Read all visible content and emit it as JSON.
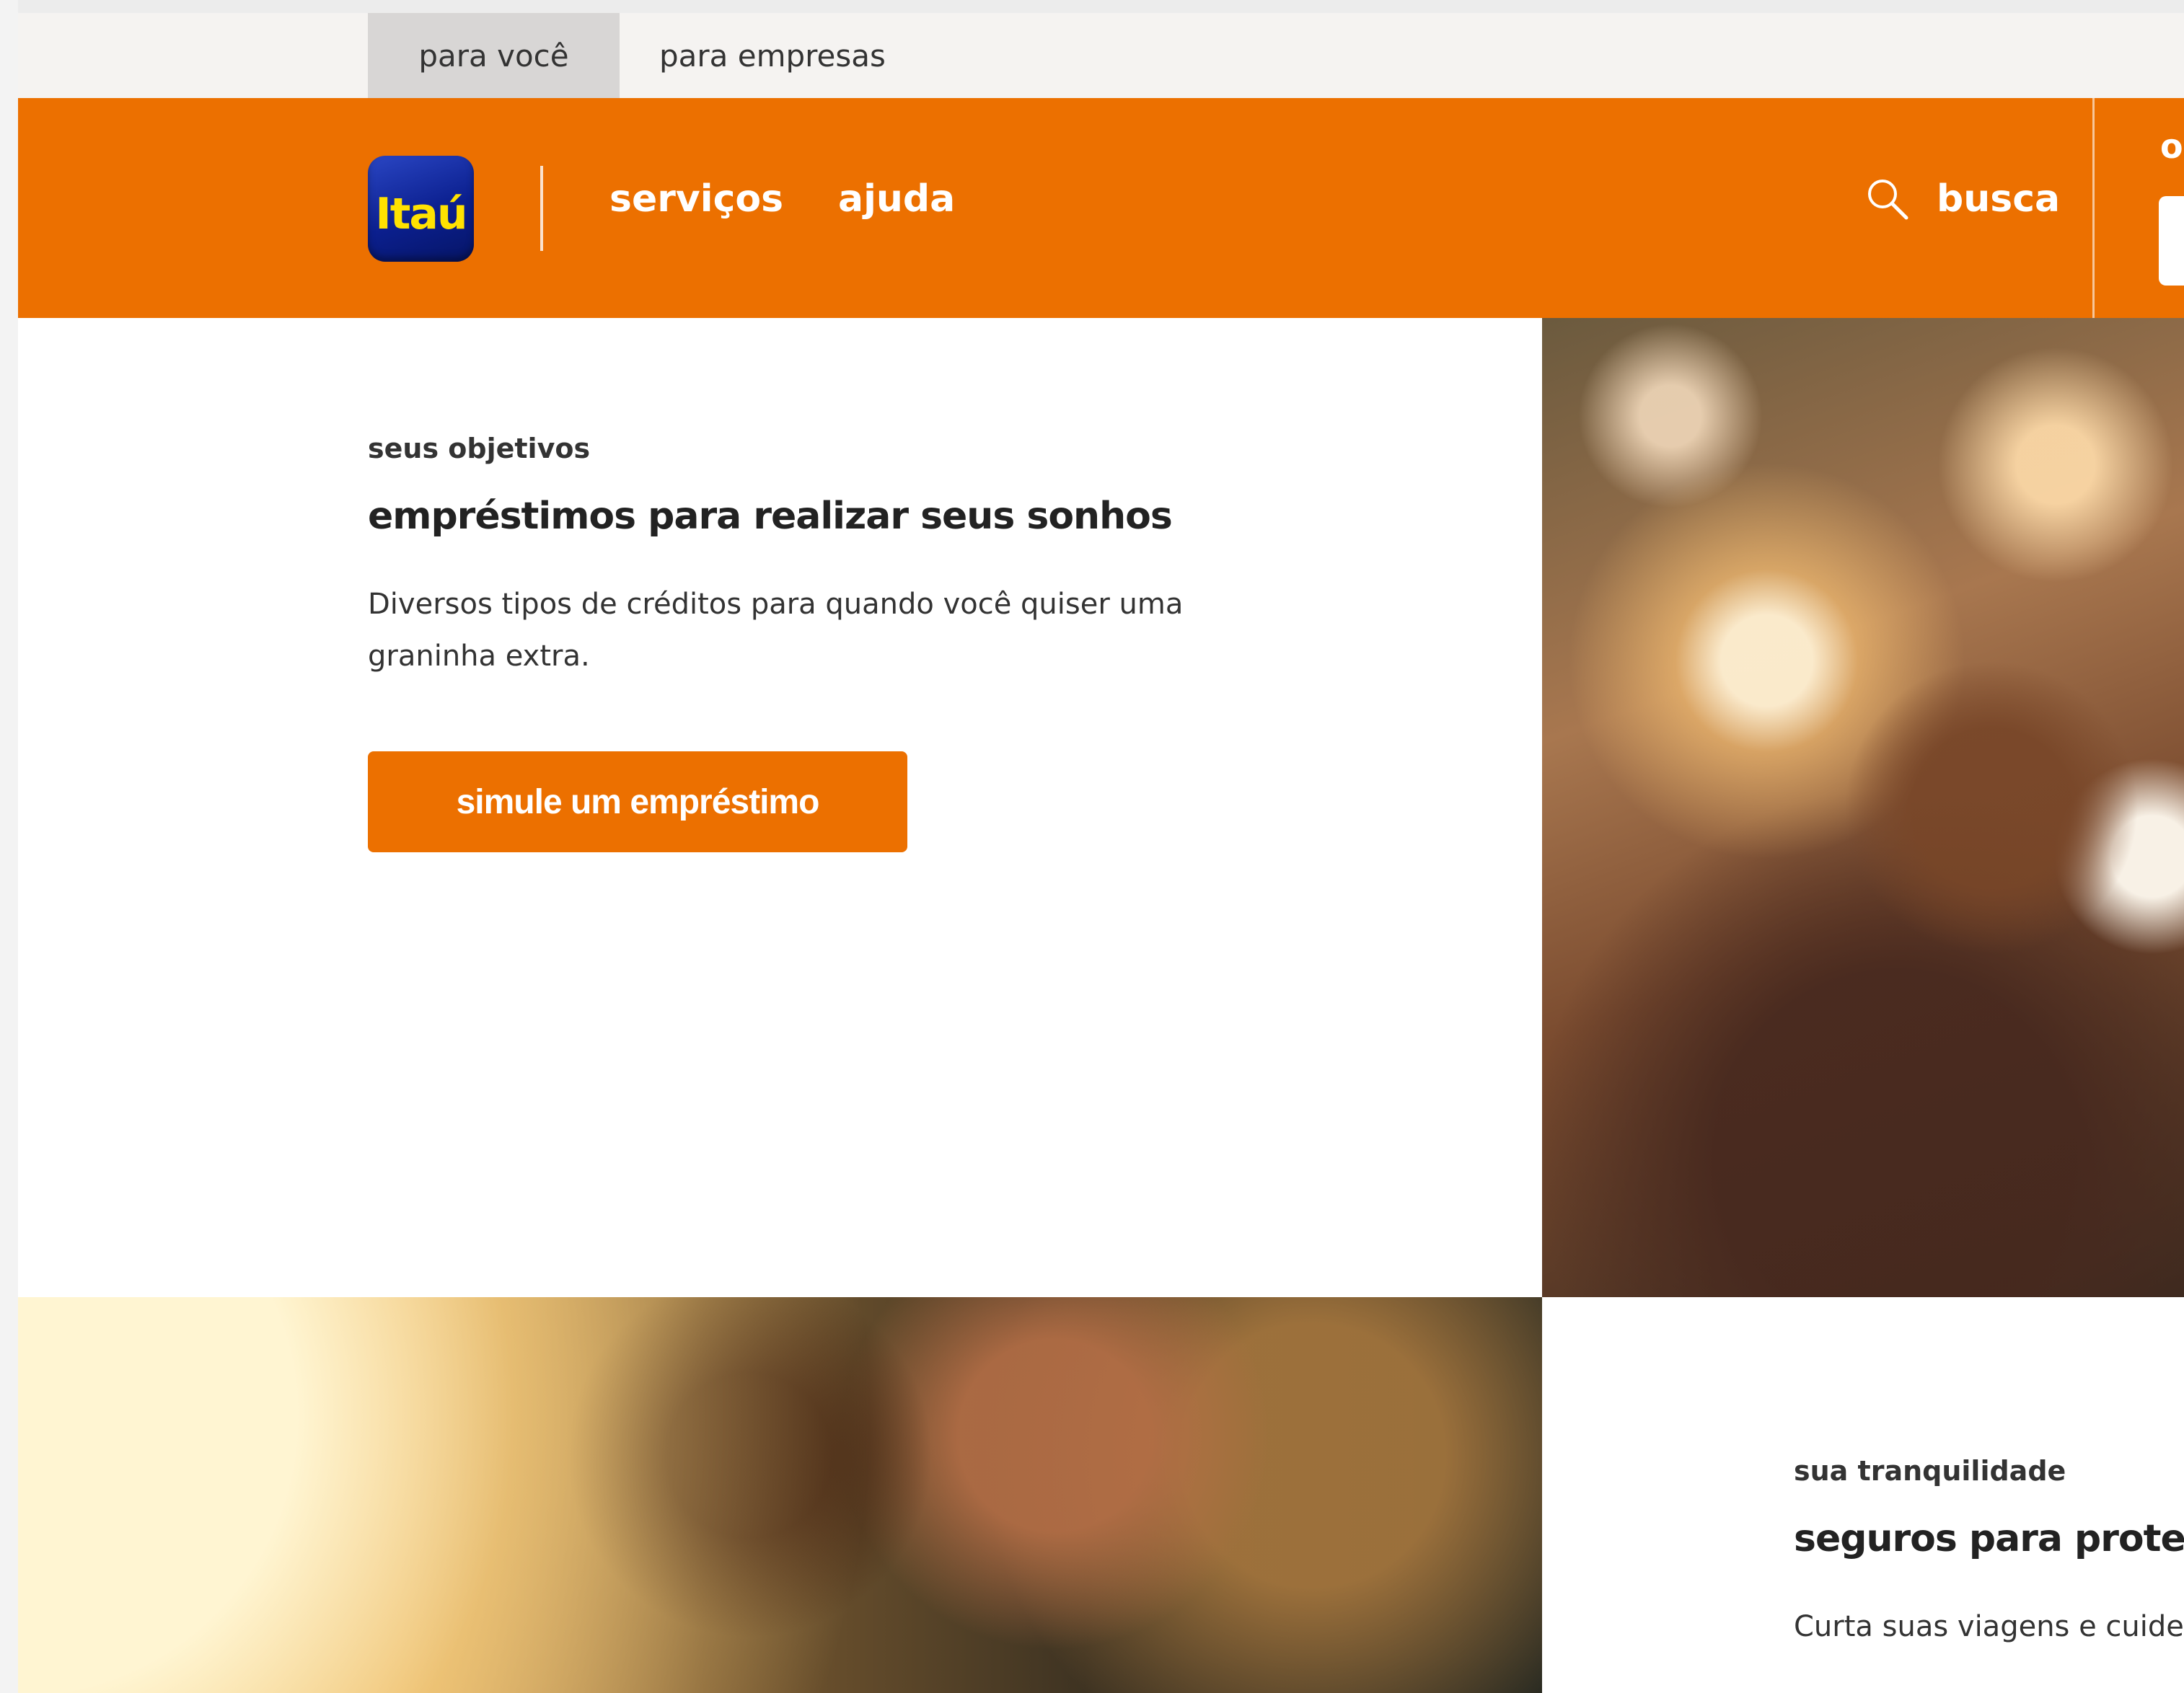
{
  "segments": {
    "personal": "para você",
    "business": "para empresas"
  },
  "header": {
    "logo_text": "Itaú",
    "nav": {
      "services": "serviços",
      "help": "ajuda",
      "search": "busca"
    },
    "peek_text": "o",
    "brand_color": "#ec7000",
    "logo_color": "#1a35b5",
    "logo_text_color": "#ffe200"
  },
  "hero": {
    "eyebrow": "seus objetivos",
    "title": "empréstimos para realizar seus sonhos",
    "description": "Diversos tipos de créditos para quando você quiser uma graninha extra.",
    "cta": "simule um empréstimo"
  },
  "section2": {
    "eyebrow": "sua tranquilidade",
    "title": "seguros para proteger",
    "description": "Curta suas viagens e cuide air"
  },
  "icons": {
    "search": "search-icon"
  }
}
